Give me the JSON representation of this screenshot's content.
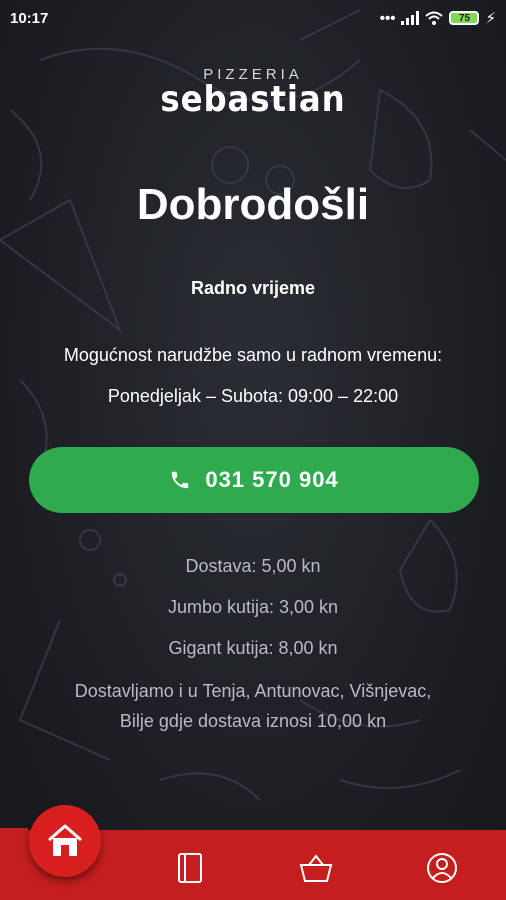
{
  "status_bar": {
    "time": "10:17",
    "battery": "75",
    "icons": [
      "dots-icon",
      "signal-icon",
      "wifi-icon",
      "battery-icon",
      "charging-icon"
    ]
  },
  "logo": {
    "top": "PIZZERIA",
    "main": "sebastian"
  },
  "title": "Dobrodošli",
  "hours": {
    "heading": "Radno vrijeme",
    "note": "Mogućnost narudžbe samo u radnom vremenu:",
    "schedule": "Ponedjeljak – Subota: 09:00 – 22:00"
  },
  "phone_button": {
    "label": "031 570 904",
    "icon": "phone-icon"
  },
  "delivery_info": {
    "delivery": "Dostava: 5,00 kn",
    "jumbo": "Jumbo kutija: 3,00 kn",
    "gigant": "Gigant kutija: 8,00 kn",
    "areas_line1": "Dostavljamo i u Tenja, Antunovac, Višnjevac,",
    "areas_line2": "Bilje gdje dostava iznosi 10,00 kn"
  },
  "nav": {
    "items": [
      "home-icon",
      "menu-book-icon",
      "basket-icon",
      "profile-icon"
    ],
    "active": "home-icon"
  },
  "colors": {
    "accent_green": "#2faa4e",
    "nav_red": "#c41e1e",
    "background": "#1d1f24"
  }
}
